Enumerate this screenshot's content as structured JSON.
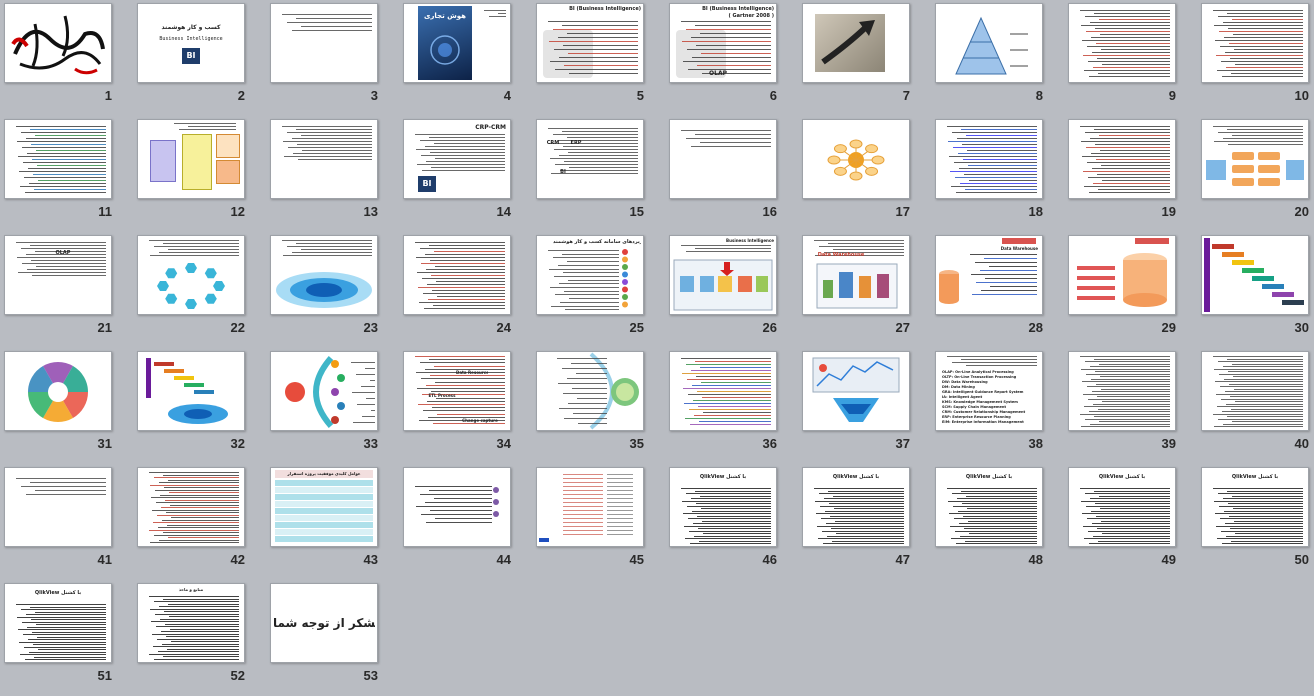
{
  "app": {
    "view": "slide-sorter",
    "background_color": "#b9bcc2"
  },
  "slides": [
    {
      "number": "1",
      "kind": "calligraphy"
    },
    {
      "number": "2",
      "kind": "title-bi",
      "title": "کسب و کار هوشمند",
      "subtitle": "Business  Intelligence",
      "badge": "BI"
    },
    {
      "number": "3",
      "kind": "text-sparse"
    },
    {
      "number": "4",
      "kind": "book-cover",
      "title": "هوش تجاری"
    },
    {
      "number": "5",
      "kind": "text-image",
      "title": "BI (Business Intelligence)"
    },
    {
      "number": "6",
      "kind": "text-image",
      "title": "BI (Business Intelligence)",
      "subtitle": "( Gartner 2008 )",
      "label": "OLAP"
    },
    {
      "number": "7",
      "kind": "arrow-photo"
    },
    {
      "number": "8",
      "kind": "pyramid"
    },
    {
      "number": "9",
      "kind": "text-red"
    },
    {
      "number": "10",
      "kind": "text-red"
    },
    {
      "number": "11",
      "kind": "text-colored"
    },
    {
      "number": "12",
      "kind": "diagram-boxes"
    },
    {
      "number": "13",
      "kind": "text"
    },
    {
      "number": "14",
      "kind": "text-bi",
      "title": "CRP-CRM",
      "badge": "BI"
    },
    {
      "number": "15",
      "kind": "text-labels",
      "labels": [
        "CRM",
        "ERP",
        "BI"
      ]
    },
    {
      "number": "16",
      "kind": "text-sparse"
    },
    {
      "number": "17",
      "kind": "star-diagram"
    },
    {
      "number": "18",
      "kind": "text-blue"
    },
    {
      "number": "19",
      "kind": "text-red"
    },
    {
      "number": "20",
      "kind": "text-flow"
    },
    {
      "number": "21",
      "kind": "text",
      "label": "OLAP"
    },
    {
      "number": "22",
      "kind": "hex-circle"
    },
    {
      "number": "23",
      "kind": "ellipse-rings"
    },
    {
      "number": "24",
      "kind": "text-red"
    },
    {
      "number": "25",
      "kind": "bullet-list",
      "title": "کاربردهای سامانه کسب و کار هوشمند"
    },
    {
      "number": "26",
      "kind": "process-diagram",
      "title": "Business Intelligence"
    },
    {
      "number": "27",
      "kind": "warehouse-diagram",
      "title": "Data Warehouse"
    },
    {
      "number": "28",
      "kind": "cylinder-text",
      "title": "Data Warehouse"
    },
    {
      "number": "29",
      "kind": "cylinder"
    },
    {
      "number": "30",
      "kind": "staircase"
    },
    {
      "number": "31",
      "kind": "pie-wheel"
    },
    {
      "number": "32",
      "kind": "staircase-ellipse"
    },
    {
      "number": "33",
      "kind": "arc-diagram"
    },
    {
      "number": "34",
      "kind": "text-mixed",
      "labels": [
        "Data Resources",
        "ETL Process",
        "Change capture"
      ]
    },
    {
      "number": "35",
      "kind": "arc-circle"
    },
    {
      "number": "36",
      "kind": "text-rainbow"
    },
    {
      "number": "37",
      "kind": "dashboard"
    },
    {
      "number": "38",
      "kind": "acronym-list",
      "lines": [
        "OLAP: On-Line Analytical Processing",
        "OLTP: On-Line Transaction Processing",
        "DW: Data Warehousing",
        "DM: Data Mining",
        "GRA: Intelligent Guidance Report System",
        "IA: Intelligent Agent",
        "KMS: Knowledge Management System",
        "SCM: Supply Chain Management",
        "CRM: Customer Relationship Management",
        "ERP: Enterprise Resource Planning",
        "EIM: Enterprise Information Management"
      ]
    },
    {
      "number": "39",
      "kind": "text-dense"
    },
    {
      "number": "40",
      "kind": "text-dense"
    },
    {
      "number": "41",
      "kind": "text-sparse"
    },
    {
      "number": "42",
      "kind": "text-dense-red"
    },
    {
      "number": "43",
      "kind": "table",
      "title": "عوامل کلیدی موفقیت پروژه استقرار"
    },
    {
      "number": "44",
      "kind": "bullets-purple"
    },
    {
      "number": "45",
      "kind": "list-table"
    },
    {
      "number": "46",
      "kind": "text-heading",
      "title": "QlikView  با  کشنل"
    },
    {
      "number": "47",
      "kind": "text-heading",
      "title": "QlikView  با  کشنل"
    },
    {
      "number": "48",
      "kind": "text-heading",
      "title": "QlikView  با  کشنل"
    },
    {
      "number": "49",
      "kind": "text-heading",
      "title": "QlikView  با  کشنل"
    },
    {
      "number": "50",
      "kind": "text-heading",
      "title": "QlikView  با  کشنل"
    },
    {
      "number": "51",
      "kind": "text-heading",
      "title": "QlikView  با  کشنل"
    },
    {
      "number": "52",
      "kind": "references",
      "title": "منابع و ماخذ"
    },
    {
      "number": "53",
      "kind": "thanks",
      "title": "با تشکر از توجه شما"
    }
  ]
}
